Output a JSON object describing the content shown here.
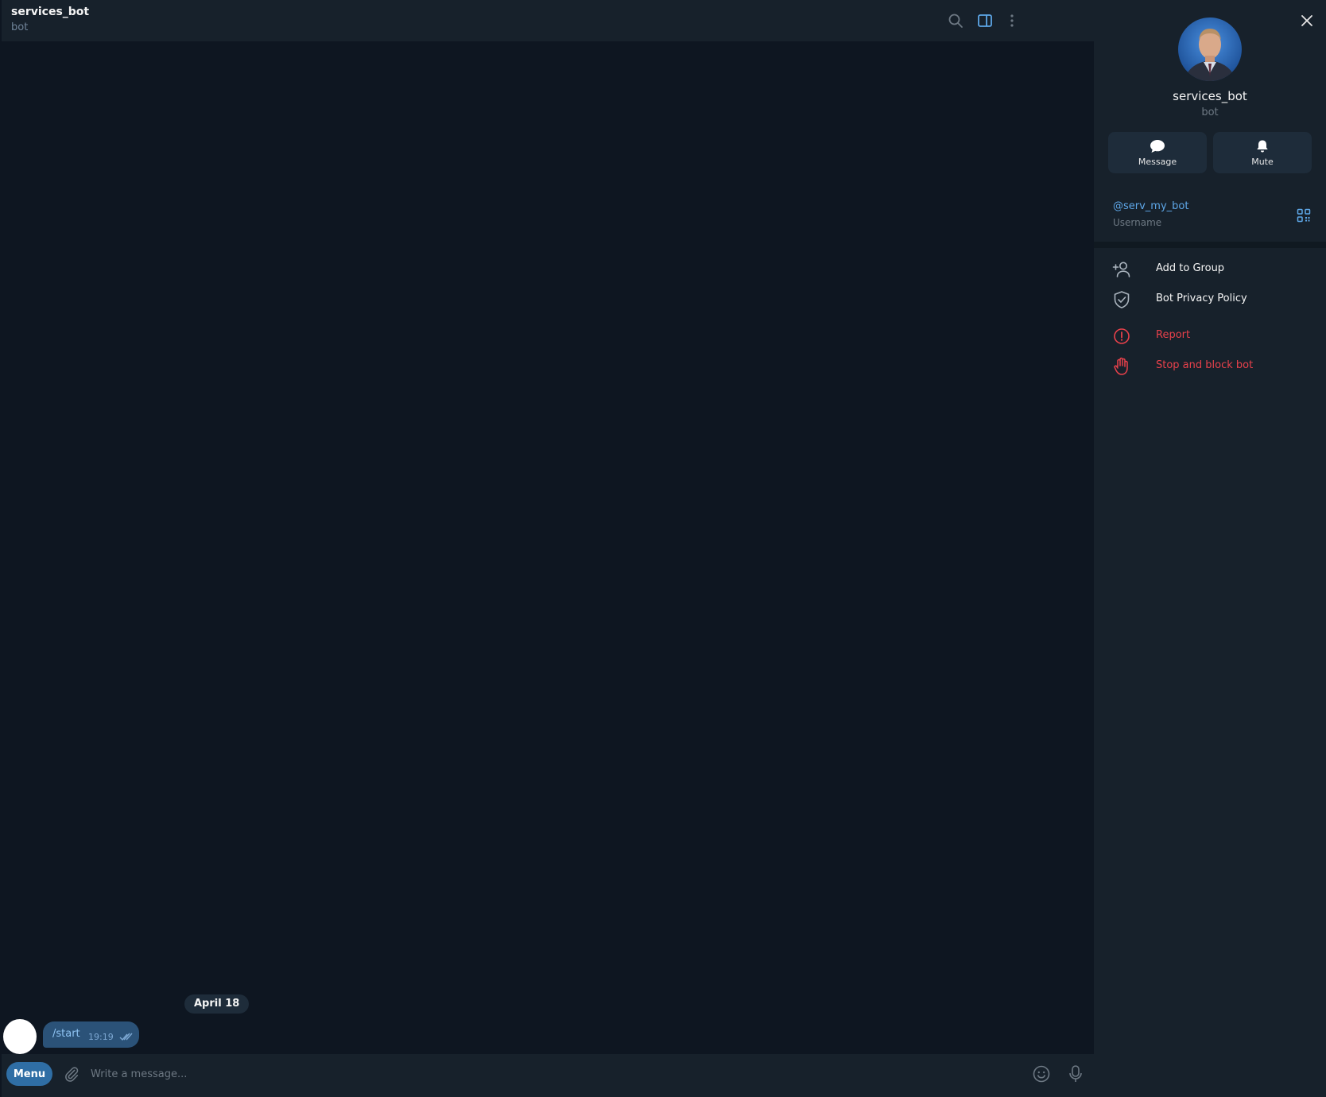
{
  "chat": {
    "title": "services_bot",
    "status": "bot",
    "date_separator": "April 18",
    "message": {
      "text": "/start",
      "time": "19:19"
    },
    "composer": {
      "menu_label": "Menu",
      "placeholder": "Write a message..."
    }
  },
  "profile": {
    "name": "services_bot",
    "status": "bot",
    "actions": [
      {
        "label": "Message",
        "icon": "chat-bubble-icon"
      },
      {
        "label": "Mute",
        "icon": "bell-icon"
      }
    ],
    "username": "@serv_my_bot",
    "username_label": "Username",
    "menu": [
      {
        "label": "Add to Group",
        "icon": "add-user-icon"
      },
      {
        "label": "Bot Privacy Policy",
        "icon": "shield-check-icon"
      },
      {
        "label": "Report",
        "icon": "alert-circle-icon",
        "danger": true
      },
      {
        "label": "Stop and block bot",
        "icon": "hand-stop-icon",
        "danger": true
      }
    ]
  },
  "colors": {
    "background": "#0e1621",
    "header": "#17212b",
    "accent": "#5ea7e8",
    "bubble": "#2b5278",
    "danger": "#e8414b"
  }
}
